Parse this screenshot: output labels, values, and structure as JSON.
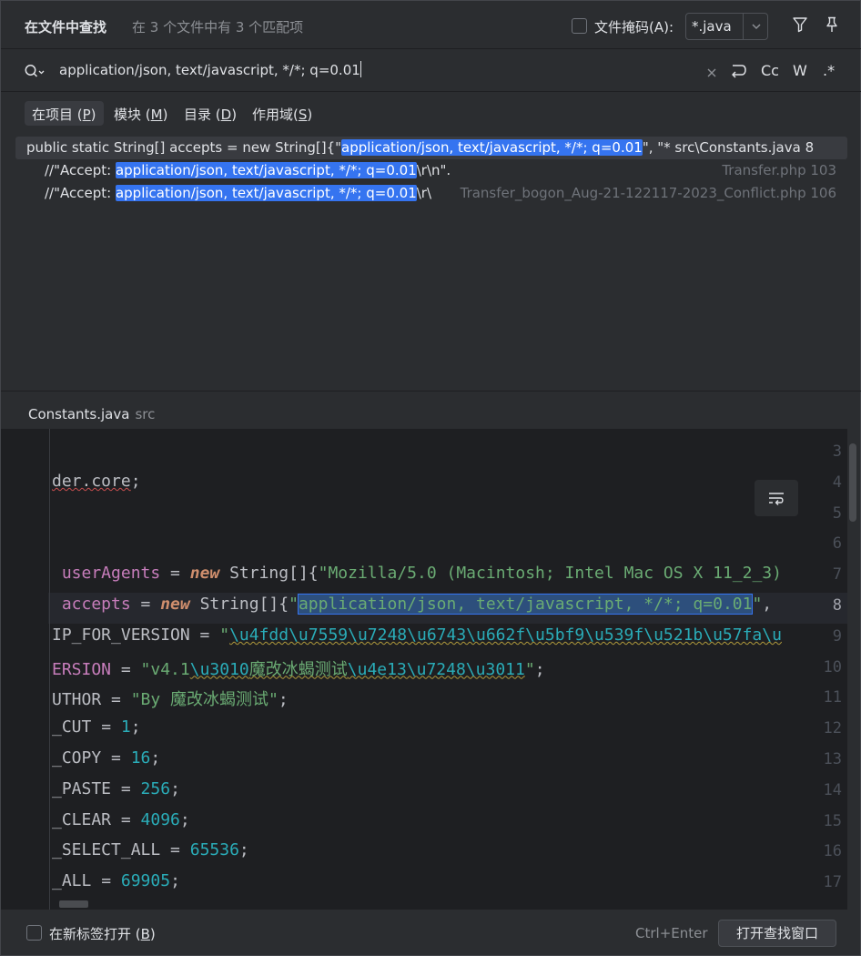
{
  "header": {
    "title": "在文件中查找",
    "summary": "在 3 个文件中有 3 个匹配项",
    "file_mask_label": "文件掩码(A):",
    "file_mask_value": "*.java",
    "filter_icon": "filter-icon",
    "pin_icon": "pin-icon"
  },
  "search": {
    "query": "application/json, text/javascript, */*; q=0.01",
    "icon": "search-history-icon",
    "clear_icon": "clear-icon",
    "options": {
      "newline": "newline-icon",
      "case": "Cc",
      "words": "W",
      "regex": ".*"
    }
  },
  "scopes": [
    {
      "label": "在项目 (P)",
      "text": "在项目 (",
      "key": "P",
      "tail": ")",
      "active": true
    },
    {
      "label": "模块 (M)",
      "text": "模块 (",
      "key": "M",
      "tail": ")",
      "active": false
    },
    {
      "label": "目录 (D)",
      "text": "目录 (",
      "key": "D",
      "tail": ")",
      "active": false
    },
    {
      "label": "作用域(S)",
      "text": "作用域(",
      "key": "S",
      "tail": ")",
      "active": false
    }
  ],
  "results": [
    {
      "before": "public static String[] accepts = new String[]{\"",
      "match": "application/json, text/javascript, */*; q=0.01",
      "after": "\", \"* src\\Constants.java 8",
      "file": "",
      "selected": true
    },
    {
      "before": "//\"Accept: ",
      "match": "application/json, text/javascript, */*; q=0.01",
      "after": "\\r\\n\".",
      "file": "Transfer.php 103",
      "selected": false
    },
    {
      "before": "//\"Accept: ",
      "match": "application/json, text/javascript, */*; q=0.01",
      "after": "\\r\\",
      "file": "Transfer_bogon_Aug-21-122117-2023_Conflict.php 106",
      "selected": false
    }
  ],
  "preview": {
    "file_name": "Constants.java",
    "dir": "src",
    "softwrap_icon": "soft-wrap-icon"
  },
  "editor_lines": [
    {
      "num": "3",
      "parts": []
    },
    {
      "num": "4",
      "parts": [
        {
          "t": "der.core",
          "c": "wavy"
        },
        {
          "t": ";",
          "c": ""
        }
      ]
    },
    {
      "num": "5",
      "parts": []
    },
    {
      "num": "6",
      "parts": []
    },
    {
      "num": "7",
      "parts": [
        {
          "t": " userAgents",
          "c": "f"
        },
        {
          "t": " = ",
          "c": ""
        },
        {
          "t": "new",
          "c": "k"
        },
        {
          "t": " String[]{",
          "c": ""
        },
        {
          "t": "\"Mozilla/5.0 (Macintosh; Intel Mac OS X 11_2_3)",
          "c": "s"
        }
      ]
    },
    {
      "num": "8",
      "parts": [
        {
          "t": " accepts",
          "c": "f"
        },
        {
          "t": " = ",
          "c": ""
        },
        {
          "t": "new",
          "c": "k"
        },
        {
          "t": " String[]{",
          "c": ""
        },
        {
          "t": "\"",
          "c": "s"
        },
        {
          "t": "application/json, text/javascript, */*; q=0.01",
          "c": "s match"
        },
        {
          "t": "\"",
          "c": "s"
        },
        {
          "t": ",",
          "c": ""
        }
      ]
    },
    {
      "num": "9",
      "parts": [
        {
          "t": "IP_FOR_VERSION",
          "c": ""
        },
        {
          "t": " = ",
          "c": ""
        },
        {
          "t": "\"",
          "c": "s"
        },
        {
          "t": "\\u4fdd\\u7559\\u7248\\u6743\\u662f\\u5bf9\\u539f\\u521b\\u57fa\\u",
          "c": "n wavy-y"
        }
      ]
    },
    {
      "num": "10",
      "parts": [
        {
          "t": "ERSION",
          "c": "f"
        },
        {
          "t": " = ",
          "c": ""
        },
        {
          "t": "\"v4.1",
          "c": "s"
        },
        {
          "t": "\\u3010",
          "c": "n wavy-y"
        },
        {
          "t": "魔改冰蝎测试",
          "c": "s wavy-y"
        },
        {
          "t": "\\u4e13\\u7248\\u3011",
          "c": "n wavy-y"
        },
        {
          "t": "\"",
          "c": "s"
        },
        {
          "t": ";",
          "c": ""
        }
      ]
    },
    {
      "num": "11",
      "parts": [
        {
          "t": "UTHOR",
          "c": ""
        },
        {
          "t": " = ",
          "c": ""
        },
        {
          "t": "\"By 魔改冰蝎测试\"",
          "c": "s"
        },
        {
          "t": ";",
          "c": ""
        }
      ]
    },
    {
      "num": "12",
      "parts": [
        {
          "t": "_CUT",
          "c": ""
        },
        {
          "t": " = ",
          "c": ""
        },
        {
          "t": "1",
          "c": "n"
        },
        {
          "t": ";",
          "c": ""
        }
      ]
    },
    {
      "num": "13",
      "parts": [
        {
          "t": "_COPY",
          "c": ""
        },
        {
          "t": " = ",
          "c": ""
        },
        {
          "t": "16",
          "c": "n"
        },
        {
          "t": ";",
          "c": ""
        }
      ]
    },
    {
      "num": "14",
      "parts": [
        {
          "t": "_PASTE",
          "c": ""
        },
        {
          "t": " = ",
          "c": ""
        },
        {
          "t": "256",
          "c": "n"
        },
        {
          "t": ";",
          "c": ""
        }
      ]
    },
    {
      "num": "15",
      "parts": [
        {
          "t": "_CLEAR",
          "c": ""
        },
        {
          "t": " = ",
          "c": ""
        },
        {
          "t": "4096",
          "c": "n"
        },
        {
          "t": ";",
          "c": ""
        }
      ]
    },
    {
      "num": "16",
      "parts": [
        {
          "t": "_SELECT_ALL",
          "c": ""
        },
        {
          "t": " = ",
          "c": ""
        },
        {
          "t": "65536",
          "c": "n"
        },
        {
          "t": ";",
          "c": ""
        }
      ]
    },
    {
      "num": "17",
      "parts": [
        {
          "t": "_ALL",
          "c": ""
        },
        {
          "t": " = ",
          "c": ""
        },
        {
          "t": "69905",
          "c": "n"
        },
        {
          "t": ";",
          "c": ""
        }
      ]
    }
  ],
  "current_line": "8",
  "footer": {
    "new_tab_label": "在新标签打开 (",
    "new_tab_key": "B",
    "new_tab_tail": ")",
    "shortcut": "Ctrl+Enter",
    "open_button": "打开查找窗口"
  },
  "colors": {
    "accent": "#3574f0",
    "background": "#2b2d30",
    "editor_background": "#1e1f22"
  }
}
